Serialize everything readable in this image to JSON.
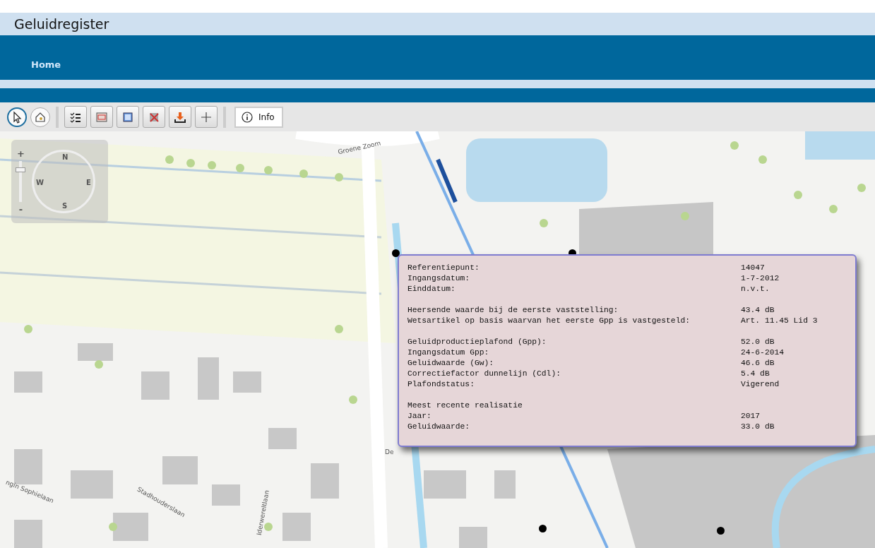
{
  "header": {
    "title": "Geluidregister"
  },
  "nav": {
    "items": [
      {
        "label": "Home",
        "selected": false
      }
    ]
  },
  "toolbar": {
    "tools": [
      {
        "kind": "round",
        "selected": true
      },
      {
        "kind": "round",
        "selected": false
      },
      {
        "kind": "separator"
      },
      {
        "kind": "square",
        "selected": false
      },
      {
        "kind": "square",
        "selected": false
      },
      {
        "kind": "square",
        "selected": false
      },
      {
        "kind": "square",
        "selected": false
      },
      {
        "kind": "square",
        "selected": false
      },
      {
        "kind": "square",
        "selected": false
      },
      {
        "kind": "separator"
      },
      {
        "kind": "labeled",
        "label": "Info",
        "selected": false
      }
    ]
  },
  "map": {
    "compass": {
      "north": "N",
      "east": "E",
      "south": "S",
      "west": "W",
      "zoom_in": "+",
      "zoom_out": "-",
      "zoom_level": {
        "level": 0.8
      }
    },
    "labels": [
      {
        "text": "Groene Zoom",
        "kind": "road"
      },
      {
        "text": "De",
        "kind": "road"
      },
      {
        "text": "Stadhouderslaan",
        "kind": "road"
      },
      {
        "text": "ngin Sophielaan",
        "kind": "road"
      },
      {
        "text": "lderwereltlaan",
        "kind": "road"
      }
    ],
    "popup": {
      "groups": [
        [
          {
            "label": "Referentiepunt:",
            "value": "14047"
          },
          {
            "label": "Ingangsdatum:",
            "value": "1-7-2012"
          },
          {
            "label": "Einddatum:",
            "value": "n.v.t."
          }
        ],
        [
          {
            "label": "Heersende waarde bij de eerste vaststelling:",
            "value": "43.4 dB"
          },
          {
            "label": "Wetsartikel op basis waarvan het eerste Gpp is vastgesteld:",
            "value": "Art. 11.45 Lid 3"
          }
        ],
        [
          {
            "label": "Geluidproductieplafond (Gpp):",
            "value": "52.0 dB"
          },
          {
            "label": "Ingangsdatum Gpp:",
            "value": "24-6-2014"
          },
          {
            "label": "Geluidwaarde (Gw):",
            "value": "46.6 dB"
          },
          {
            "label": "Correctiefactor dunnelijn (Cdl):",
            "value": "5.4 dB"
          },
          {
            "label": "Plafondstatus:",
            "value": "Vigerend"
          }
        ],
        [
          {
            "label": "Meest recente realisatie"
          },
          {
            "label": "Jaar:",
            "value": "2017"
          },
          {
            "label": "Geluidwaarde:",
            "value": "33.0 dB"
          }
        ]
      ]
    }
  }
}
